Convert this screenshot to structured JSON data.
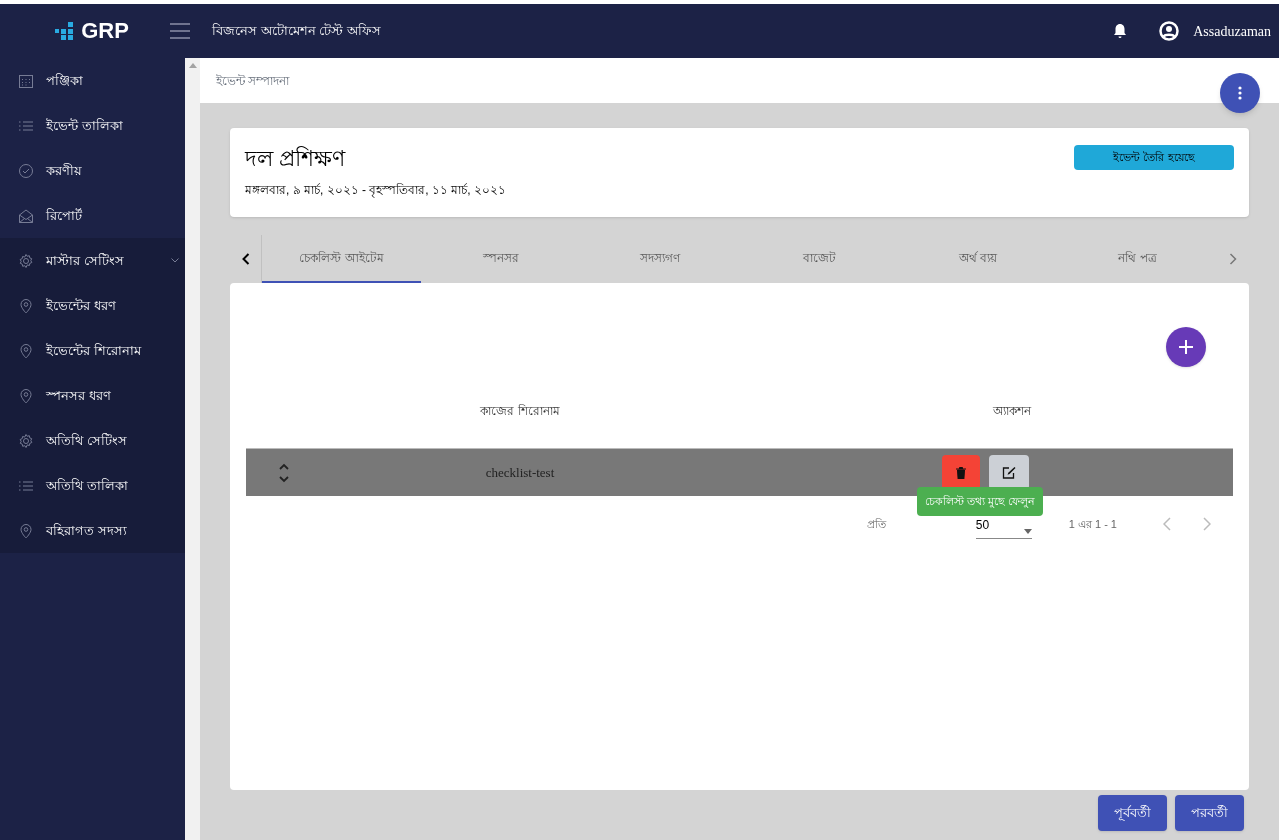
{
  "header": {
    "logo": "GRP",
    "title": "বিজনেস অটোমেশন টেস্ট অফিস",
    "user": "Assaduzaman"
  },
  "sidebar": {
    "items": [
      {
        "label": "পঞ্জিকা"
      },
      {
        "label": "ইভেন্ট তালিকা"
      },
      {
        "label": "করণীয়"
      },
      {
        "label": "রিপোর্ট"
      },
      {
        "label": "মাস্টার সেটিংস",
        "expanded": true,
        "children": [
          {
            "label": "ইভেন্টের ধরণ"
          },
          {
            "label": "ইভেন্টের শিরোনাম"
          },
          {
            "label": "স্পনসর ধরণ"
          },
          {
            "label": "অতিথি সেটিংস"
          },
          {
            "label": "অতিথি তালিকা"
          },
          {
            "label": "বহিরাগত সদস্য"
          }
        ]
      }
    ]
  },
  "breadcrumb": "ইভেন্ট সম্পাদনা",
  "event": {
    "title": "দল প্রশিক্ষণ",
    "dates": "মঙ্গলবার, ৯ মার্চ, ২০২১ - বৃহস্পতিবার, ১১ মার্চ, ২০২১",
    "status": "ইভেন্ট তৈরি হয়েছে"
  },
  "tabs": [
    {
      "label": "চেকলিস্ট আইটেম",
      "selected": true
    },
    {
      "label": "স্পনসর",
      "selected": false
    },
    {
      "label": "সদস্যগণ",
      "selected": false
    },
    {
      "label": "বাজেট",
      "selected": false
    },
    {
      "label": "অর্থ ব্যয়",
      "selected": false
    },
    {
      "label": "নথি পত্র",
      "selected": false
    }
  ],
  "table": {
    "columns": [
      "কাজের শিরোনাম",
      "অ্যাকশন"
    ],
    "rows": [
      {
        "title": "checklist-test"
      }
    ]
  },
  "tooltip": "চেকলিস্ট তথ্য মুছে ফেলুন",
  "pagination": {
    "label": "প্রতি",
    "page_size": "50",
    "range": "1 এর 1 - 1"
  },
  "buttons": [
    "পূর্ববর্তী",
    "পরবর্তী"
  ]
}
